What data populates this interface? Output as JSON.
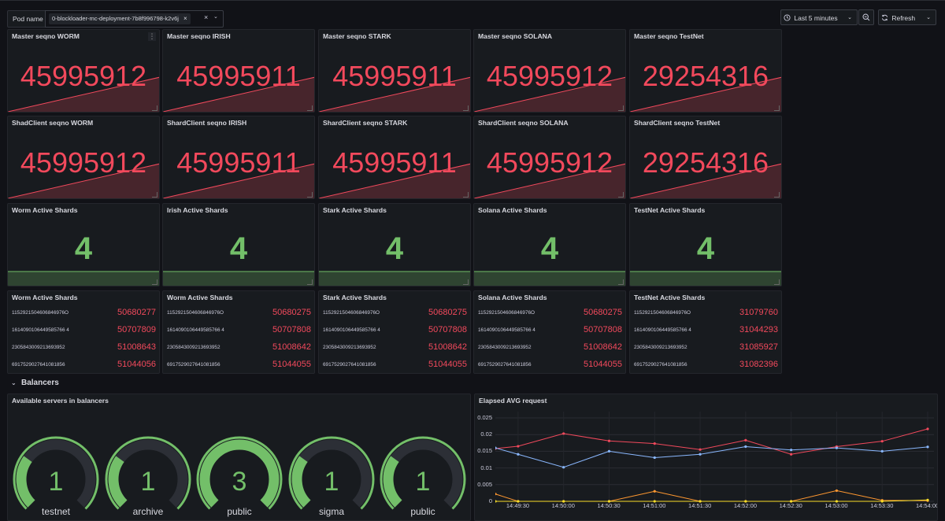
{
  "topbar": {
    "var_label": "Pod name",
    "pod_value": "0-blockloader-mc-deployment-7b8f996798-k2v6j",
    "chip_remove": "×",
    "clear": "×",
    "caret": "⌄",
    "time_range": "Last 5 minutes",
    "refresh": "Refresh"
  },
  "icons": {
    "clock": "clock-icon",
    "zoom_out": "zoom-out-icon",
    "refresh": "refresh-icon"
  },
  "colors": {
    "red": "#f2495c",
    "green": "#73bf69",
    "blue": "#8ab8ff",
    "orange": "#ff9830",
    "yellow": "#fade2a",
    "panel_bg": "#181b1f",
    "page_bg": "#111217"
  },
  "master_panels": [
    {
      "title": "Master seqno WORM",
      "value": "45995912"
    },
    {
      "title": "Master seqno IRISH",
      "value": "45995911"
    },
    {
      "title": "Master seqno STARK",
      "value": "45995911"
    },
    {
      "title": "Master seqno SOLANA",
      "value": "45995912"
    },
    {
      "title": "Master seqno TestNet",
      "value": "29254316"
    }
  ],
  "shard_panels": [
    {
      "title": "ShadClient seqno WORM",
      "value": "45995912"
    },
    {
      "title": "ShardClient seqno IRISH",
      "value": "45995911"
    },
    {
      "title": "ShardClient seqno STARK",
      "value": "45995911"
    },
    {
      "title": "ShardClient seqno SOLANA",
      "value": "45995912"
    },
    {
      "title": "ShardClient seqno TestNet",
      "value": "29254316"
    }
  ],
  "active_panels": [
    {
      "title": "Worm Active Shards",
      "value": "4"
    },
    {
      "title": "Irish Active Shards",
      "value": "4"
    },
    {
      "title": "Stark Active Shards",
      "value": "4"
    },
    {
      "title": "Solana Active Shards",
      "value": "4"
    },
    {
      "title": "TestNet Active Shards",
      "value": "4"
    }
  ],
  "shard_list_panels": [
    {
      "title": "Worm Active Shards",
      "rows": [
        {
          "name": "1152921504606846976O",
          "value": "50680277"
        },
        {
          "name": "1614090106449585766 4",
          "value": "50707809"
        },
        {
          "name": "2305843009213693952",
          "value": "51008643"
        },
        {
          "name": "6917529027641081856",
          "value": "51044056"
        }
      ]
    },
    {
      "title": "Worm Active Shards",
      "rows": [
        {
          "name": "1152921504606846976O",
          "value": "50680275"
        },
        {
          "name": "1614090106449585766 4",
          "value": "50707808"
        },
        {
          "name": "2305843009213693952",
          "value": "51008642"
        },
        {
          "name": "6917529027641081856",
          "value": "51044055"
        }
      ]
    },
    {
      "title": "Stark Active Shards",
      "rows": [
        {
          "name": "1152921504606846976O",
          "value": "50680275"
        },
        {
          "name": "1614090106449585766 4",
          "value": "50707808"
        },
        {
          "name": "2305843009213693952",
          "value": "51008642"
        },
        {
          "name": "6917529027641081856",
          "value": "51044055"
        }
      ]
    },
    {
      "title": "Solana Active Shards",
      "rows": [
        {
          "name": "1152921504606846976O",
          "value": "50680275"
        },
        {
          "name": "1614090106449585766 4",
          "value": "50707808"
        },
        {
          "name": "2305843009213693952",
          "value": "51008642"
        },
        {
          "name": "6917529027641081856",
          "value": "51044055"
        }
      ]
    },
    {
      "title": "TestNet Active Shards",
      "rows": [
        {
          "name": "1152921504606846976O",
          "value": "31079760"
        },
        {
          "name": "1614090106449585766 4",
          "value": "31044293"
        },
        {
          "name": "2305843009213693952",
          "value": "31085927"
        },
        {
          "name": "6917529027641081856",
          "value": "31082396"
        }
      ]
    }
  ],
  "balancers_row": {
    "title": "Balancers",
    "caret": "⌄"
  },
  "servers_panel": {
    "title": "Available servers in balancers",
    "gauges": [
      {
        "label": "testnet",
        "value": "1",
        "fraction": 0.3
      },
      {
        "label": "archive",
        "value": "1",
        "fraction": 0.3
      },
      {
        "label": "public",
        "value": "3",
        "fraction": 1.0
      },
      {
        "label": "sigma",
        "value": "1",
        "fraction": 0.3
      },
      {
        "label": "public",
        "value": "1",
        "fraction": 0.3
      }
    ]
  },
  "chart_data": {
    "type": "line",
    "title": "Elapsed AVG request",
    "xlabel": "",
    "ylabel": "",
    "ylim": [
      0,
      0.025
    ],
    "y_ticks": [
      "0.025",
      "0.02",
      "0.015",
      "0.01",
      "0.005",
      "0"
    ],
    "x": [
      "14:49:30",
      "14:50:00",
      "14:50:30",
      "14:51:00",
      "14:51:30",
      "14:52:00",
      "14:52:30",
      "14:53:00",
      "14:53:30",
      "14:54:00"
    ],
    "x_start": "14:49:15",
    "x_end": "14:54:00",
    "grid": true,
    "series": [
      {
        "color": "#f2495c",
        "points": [
          [
            "14:49:15",
            0.0158
          ],
          [
            "14:49:30",
            0.0165
          ],
          [
            "14:50:00",
            0.0203
          ],
          [
            "14:50:30",
            0.0181
          ],
          [
            "14:51:00",
            0.0173
          ],
          [
            "14:51:30",
            0.0155
          ],
          [
            "14:52:00",
            0.0183
          ],
          [
            "14:52:30",
            0.0141
          ],
          [
            "14:53:00",
            0.0164
          ],
          [
            "14:53:30",
            0.018
          ],
          [
            "14:54:00",
            0.0217
          ]
        ]
      },
      {
        "color": "#8ab8ff",
        "points": [
          [
            "14:49:15",
            0.016
          ],
          [
            "14:49:30",
            0.0141
          ],
          [
            "14:50:00",
            0.0102
          ],
          [
            "14:50:30",
            0.015
          ],
          [
            "14:51:00",
            0.0131
          ],
          [
            "14:51:30",
            0.0141
          ],
          [
            "14:52:00",
            0.0164
          ],
          [
            "14:52:30",
            0.0154
          ],
          [
            "14:53:00",
            0.016
          ],
          [
            "14:53:30",
            0.015
          ],
          [
            "14:54:00",
            0.0163
          ]
        ]
      },
      {
        "color": "#ff9830",
        "points": [
          [
            "14:49:15",
            0.0022
          ],
          [
            "14:49:30",
            0.0
          ],
          [
            "14:50:00",
            0.0
          ],
          [
            "14:50:30",
            0.0
          ],
          [
            "14:51:00",
            0.003
          ],
          [
            "14:51:30",
            0.0
          ],
          [
            "14:52:00",
            0.0
          ],
          [
            "14:52:30",
            0.0
          ],
          [
            "14:53:00",
            0.0032
          ],
          [
            "14:53:30",
            0.0003
          ],
          [
            "14:54:00",
            0.0002
          ]
        ]
      },
      {
        "color": "#fade2a",
        "points": [
          [
            "14:49:15",
            0.0
          ],
          [
            "14:49:30",
            0.0
          ],
          [
            "14:50:00",
            0.0
          ],
          [
            "14:50:30",
            0.0
          ],
          [
            "14:51:00",
            0.0
          ],
          [
            "14:51:30",
            0.0
          ],
          [
            "14:52:00",
            0.0
          ],
          [
            "14:52:30",
            0.0
          ],
          [
            "14:53:00",
            0.0
          ],
          [
            "14:53:30",
            0.0
          ],
          [
            "14:54:00",
            0.0004
          ]
        ]
      }
    ]
  }
}
